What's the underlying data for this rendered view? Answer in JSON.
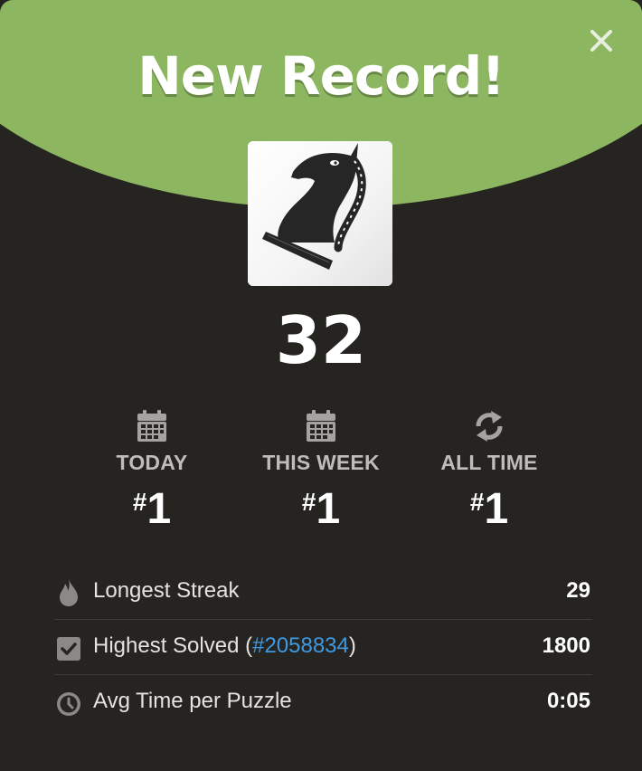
{
  "header": {
    "title": "New Record!",
    "accent_color": "#8cb65f",
    "close_icon": "close-icon"
  },
  "puzzle_image": {
    "icon": "knight-icon"
  },
  "score": "32",
  "ranks": [
    {
      "icon": "calendar-icon",
      "label": "TODAY",
      "hash": "#",
      "value": "1"
    },
    {
      "icon": "calendar-icon",
      "label": "THIS WEEK",
      "hash": "#",
      "value": "1"
    },
    {
      "icon": "refresh-icon",
      "label": "ALL TIME",
      "hash": "#",
      "value": "1"
    }
  ],
  "stats": {
    "longest_streak": {
      "icon": "flame-icon",
      "label": "Longest Streak",
      "value": "29"
    },
    "highest_solved": {
      "icon": "checkbox-icon",
      "label_prefix": "Highest Solved (",
      "link_text": "#2058834",
      "label_suffix": ")",
      "value": "1800",
      "link_color": "#3d9ae2"
    },
    "avg_time": {
      "icon": "clock-icon",
      "label": "Avg Time per Puzzle",
      "value": "0:05"
    }
  }
}
